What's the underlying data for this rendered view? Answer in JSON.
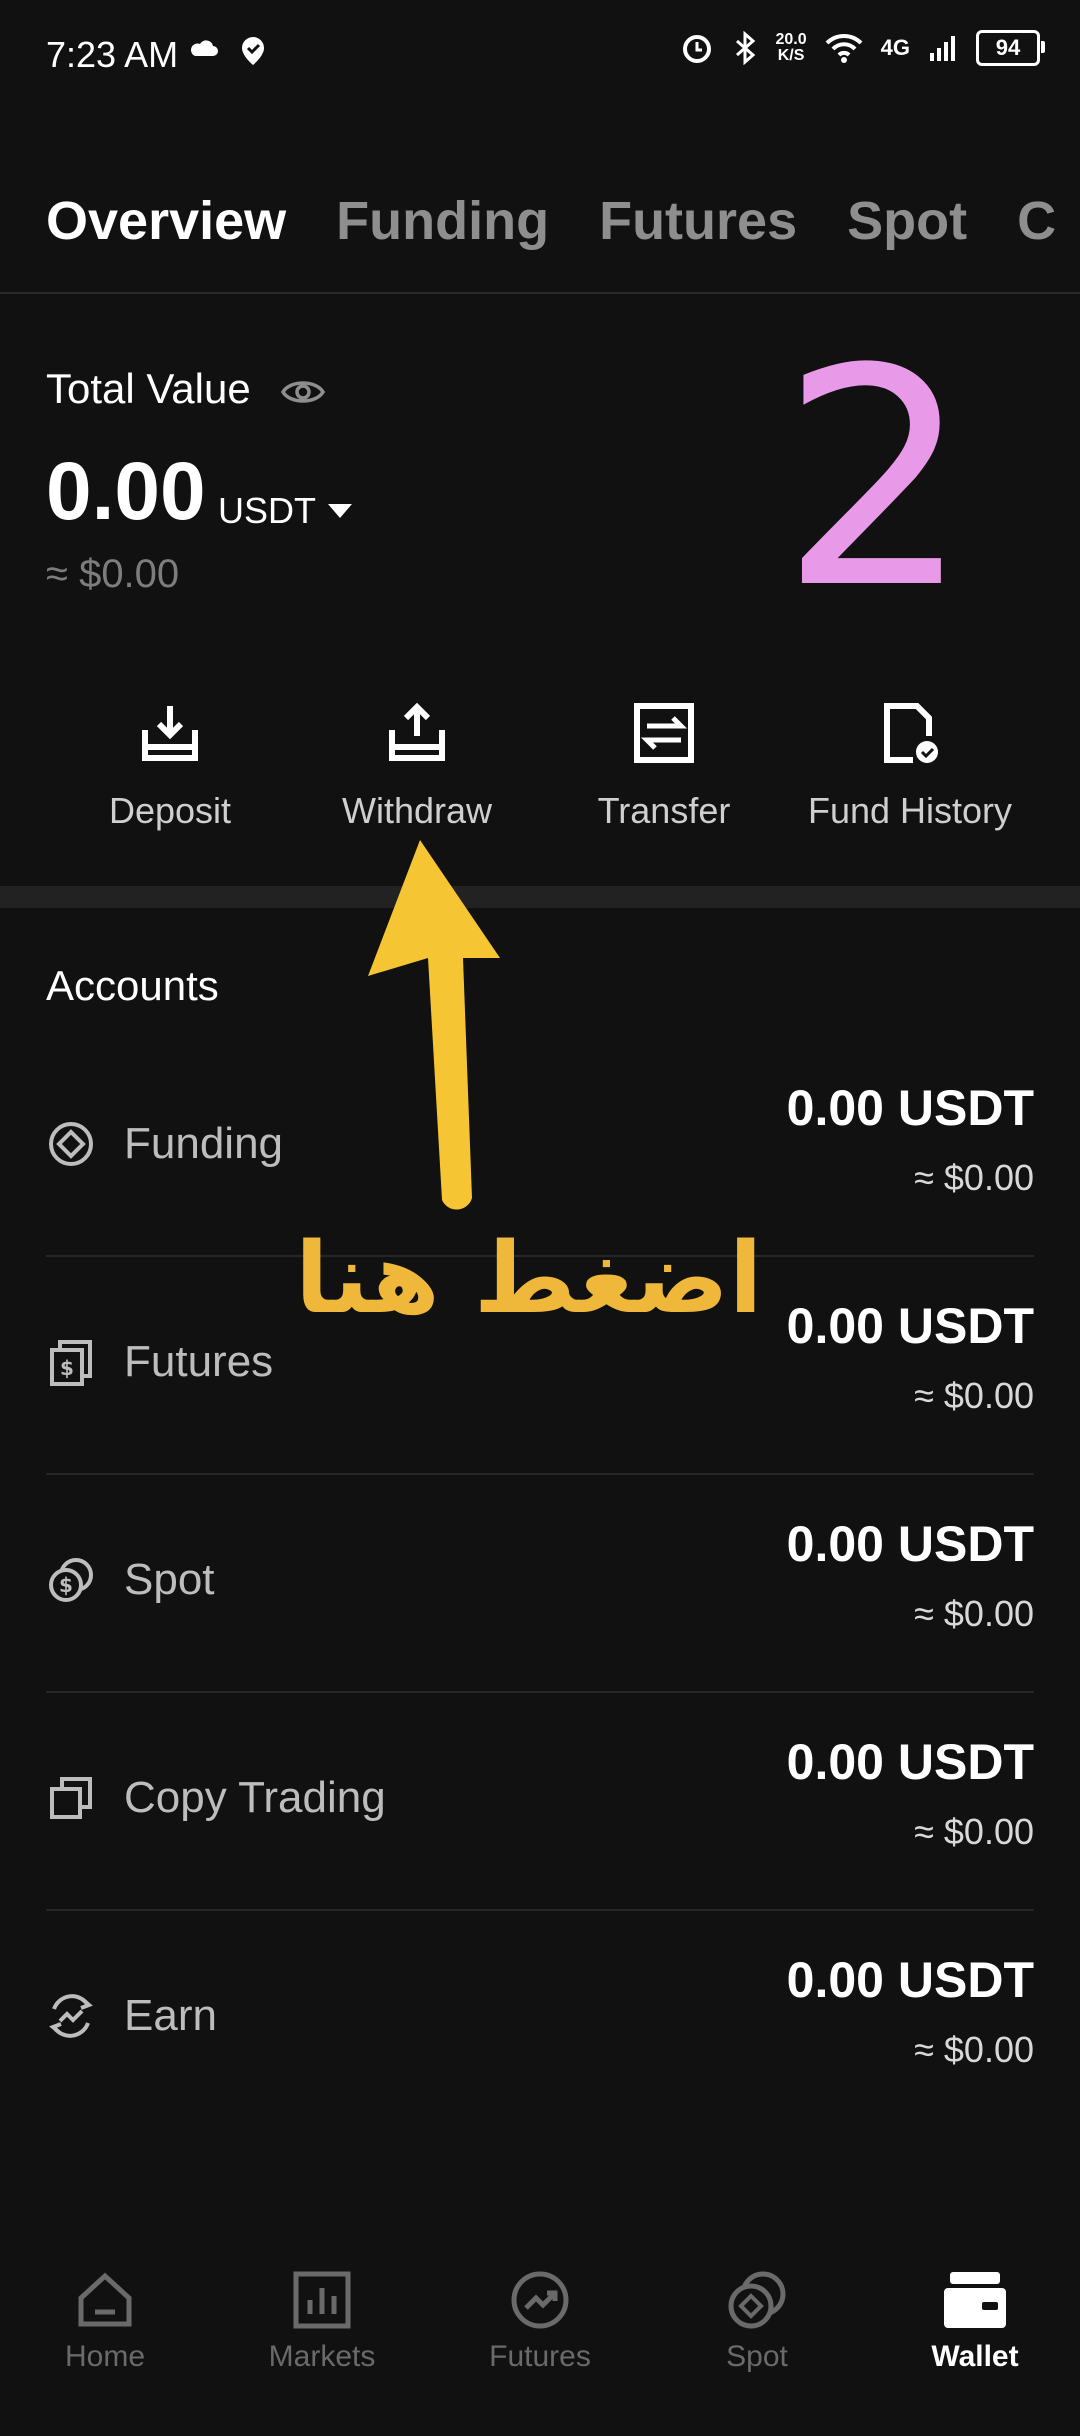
{
  "status_bar": {
    "time": "7:23 AM",
    "speed_top": "20.0",
    "speed_bottom": "K/S",
    "network": "4G",
    "battery": "94"
  },
  "tabs": [
    {
      "label": "Overview",
      "active": true
    },
    {
      "label": "Funding",
      "active": false
    },
    {
      "label": "Futures",
      "active": false
    },
    {
      "label": "Spot",
      "active": false
    },
    {
      "label": "C",
      "active": false
    }
  ],
  "total_value": {
    "label": "Total Value",
    "amount": "0.00",
    "unit": "USDT",
    "approx": "≈ $0.00"
  },
  "annotation": {
    "number": "2",
    "arabic_text": "اضغط هنا"
  },
  "actions": [
    {
      "label": "Deposit",
      "icon": "deposit-icon"
    },
    {
      "label": "Withdraw",
      "icon": "withdraw-icon"
    },
    {
      "label": "Transfer",
      "icon": "transfer-icon"
    },
    {
      "label": "Fund History",
      "icon": "fund-history-icon"
    }
  ],
  "accounts": {
    "title": "Accounts",
    "items": [
      {
        "name": "Funding",
        "amount": "0.00 USDT",
        "approx": "≈ $0.00",
        "icon": "funding-icon"
      },
      {
        "name": "Futures",
        "amount": "0.00 USDT",
        "approx": "≈ $0.00",
        "icon": "futures-icon"
      },
      {
        "name": "Spot",
        "amount": "0.00 USDT",
        "approx": "≈ $0.00",
        "icon": "spot-icon"
      },
      {
        "name": "Copy Trading",
        "amount": "0.00 USDT",
        "approx": "≈ $0.00",
        "icon": "copy-trading-icon"
      },
      {
        "name": "Earn",
        "amount": "0.00 USDT",
        "approx": "≈ $0.00",
        "icon": "earn-icon"
      }
    ]
  },
  "bottom_nav": [
    {
      "label": "Home",
      "icon": "home-icon",
      "active": false
    },
    {
      "label": "Markets",
      "icon": "markets-icon",
      "active": false
    },
    {
      "label": "Futures",
      "icon": "futures-nav-icon",
      "active": false
    },
    {
      "label": "Spot",
      "icon": "spot-nav-icon",
      "active": false
    },
    {
      "label": "Wallet",
      "icon": "wallet-icon",
      "active": true
    }
  ],
  "colors": {
    "background": "#111111",
    "annotation_number": "#e89ae8",
    "annotation_arrow": "#f5c533",
    "muted_text": "#8e8e8e"
  }
}
